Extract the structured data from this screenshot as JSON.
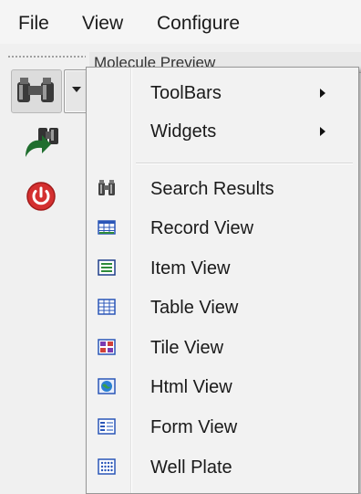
{
  "menubar": {
    "file": "File",
    "view": "View",
    "configure": "Configure"
  },
  "background_tab": {
    "title": "Molecule Preview"
  },
  "toolbar": {
    "icons": [
      "binoculars-icon",
      "dropdown-arrow-icon",
      "binoculars-back-icon",
      "power-icon"
    ]
  },
  "menu": {
    "submenus": [
      {
        "label": "ToolBars"
      },
      {
        "label": "Widgets"
      }
    ],
    "items": [
      {
        "label": "Search Results",
        "icon": "binoculars-icon"
      },
      {
        "label": "Record View",
        "icon": "record-view-icon"
      },
      {
        "label": "Item View",
        "icon": "item-view-icon"
      },
      {
        "label": "Table View",
        "icon": "table-view-icon"
      },
      {
        "label": "Tile View",
        "icon": "tile-view-icon"
      },
      {
        "label": "Html View",
        "icon": "html-view-icon"
      },
      {
        "label": "Form View",
        "icon": "form-view-icon"
      },
      {
        "label": "Well Plate",
        "icon": "well-plate-icon"
      }
    ]
  },
  "colors": {
    "menu_bg": "#f2f2f2",
    "icon_blue": "#2a56b8",
    "icon_green": "#2e8b3a",
    "power_red": "#d43030"
  }
}
